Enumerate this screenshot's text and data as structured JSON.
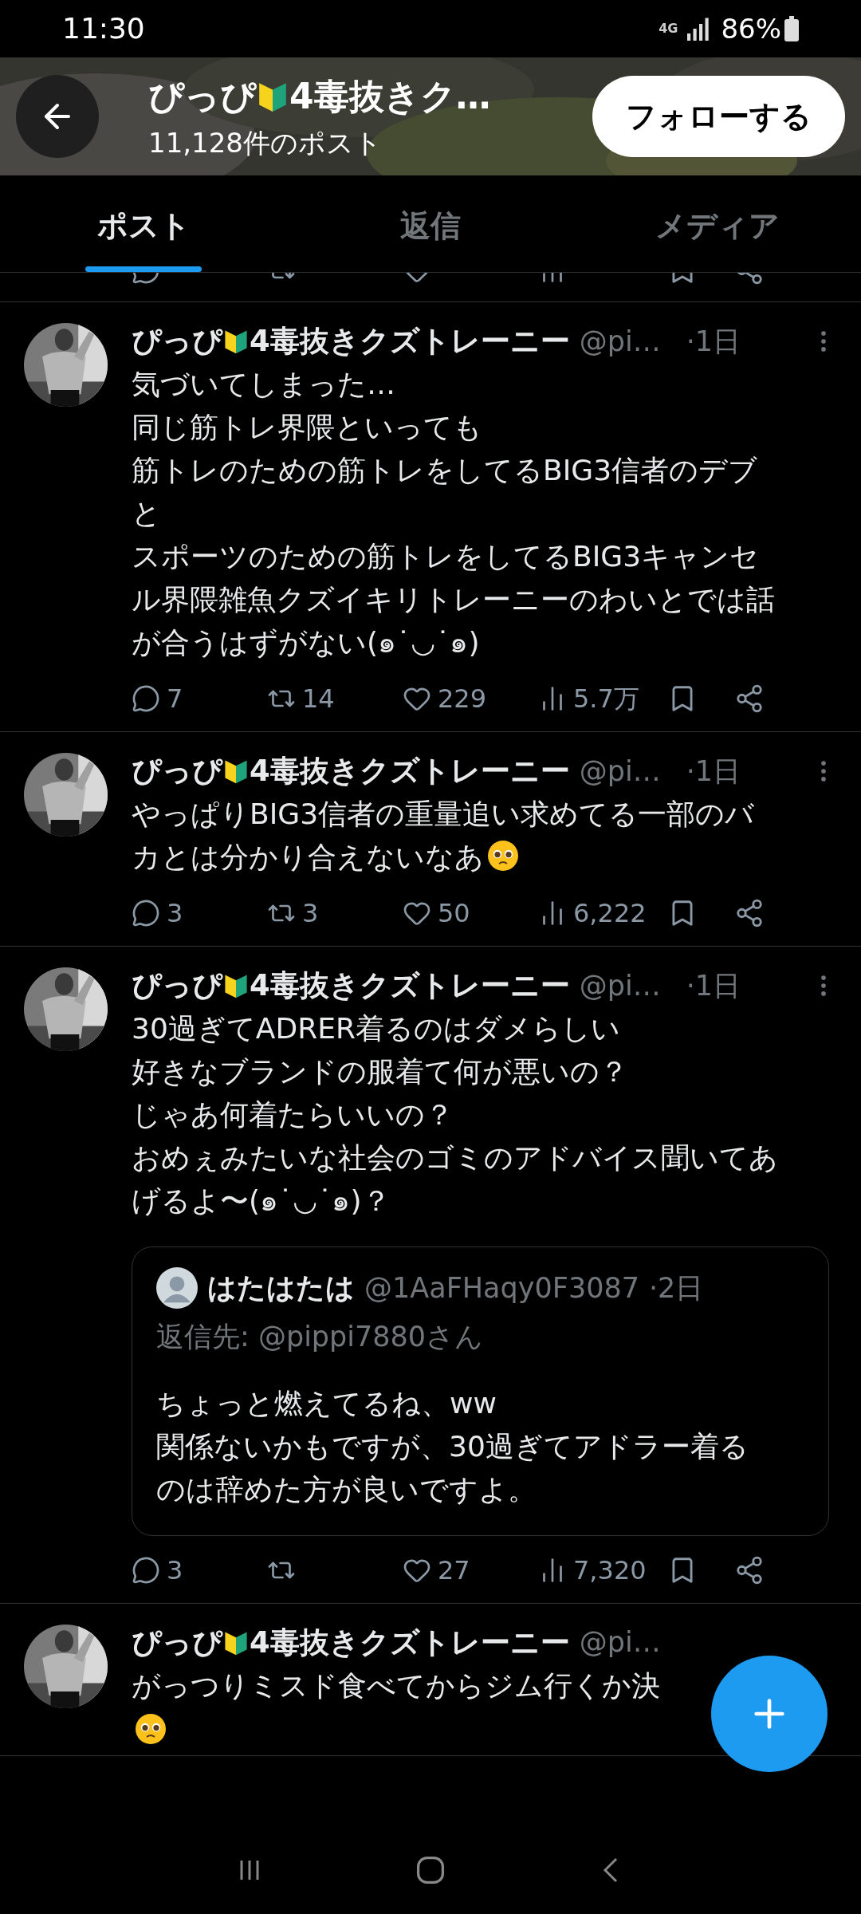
{
  "status_bar": {
    "time": "11:30",
    "network": "4G",
    "battery": "86%"
  },
  "header": {
    "name_before": "ぴっぴ",
    "name_after": "4毒抜きク…",
    "post_count": "11,128件のポスト",
    "follow_button": "フォローする"
  },
  "tabs": [
    {
      "label": "ポスト",
      "selected": true
    },
    {
      "label": "返信",
      "selected": false
    },
    {
      "label": "メディア",
      "selected": false
    }
  ],
  "posts": [
    {
      "name_before": "ぴっぴ",
      "name_after": "4毒抜きクズトレーニー",
      "handle": "@pi…",
      "time": "·1日",
      "menu": true,
      "lines": [
        "気づいてしまった…",
        "同じ筋トレ界隈といっても",
        "筋トレのための筋トレをしてるBIG3信者のデブ",
        "と",
        "スポーツのための筋トレをしてるBIG3キャンセ",
        "ル界隈雑魚クズイキリトレーニーのわいとでは話",
        "が合うはずがない(๑˙◡˙๑)"
      ],
      "trailing_emoji": false,
      "stats": {
        "replies": "7",
        "reposts": "14",
        "likes": "229",
        "views": "5.7万"
      }
    },
    {
      "name_before": "ぴっぴ",
      "name_after": "4毒抜きクズトレーニー",
      "handle": "@pi…",
      "time": "·1日",
      "menu": true,
      "lines": [
        "やっぱりBIG3信者の重量追い求めてる一部のバ",
        "カとは分かり合えないなあ"
      ],
      "trailing_emoji": true,
      "emoji_own_line": false,
      "stats": {
        "replies": "3",
        "reposts": "3",
        "likes": "50",
        "views": "6,222"
      }
    },
    {
      "name_before": "ぴっぴ",
      "name_after": "4毒抜きクズトレーニー",
      "handle": "@pi…",
      "time": "·1日",
      "menu": true,
      "lines": [
        "30過ぎてADRER着るのはダメらしい",
        "好きなブランドの服着て何が悪いの？",
        "じゃあ何着たらいいの？",
        "おめぇみたいな社会のゴミのアドバイス聞いてあ",
        "げるよ〜(๑˙◡˙๑)？"
      ],
      "trailing_emoji": false,
      "quote": {
        "name": "はたはたは",
        "handle": "@1AaFHaqy0F3087",
        "time": "·2日",
        "reply_to": "返信先: @pippi7880さん",
        "lines": [
          "ちょっと燃えてるね、ww",
          "関係ないかもですが、30過ぎてアドラー着る",
          "のは辞めた方が良いですよ。"
        ]
      },
      "stats": {
        "replies": "3",
        "likes": "27",
        "views": "7,320"
      }
    },
    {
      "name_before": "ぴっぴ",
      "name_after": "4毒抜きクズトレーニー",
      "handle": "@pi…",
      "menu": false,
      "lines": [
        "がっつりミスド食べてからジム行くか決"
      ],
      "trailing_emoji": true,
      "emoji_own_line": true
    }
  ]
}
